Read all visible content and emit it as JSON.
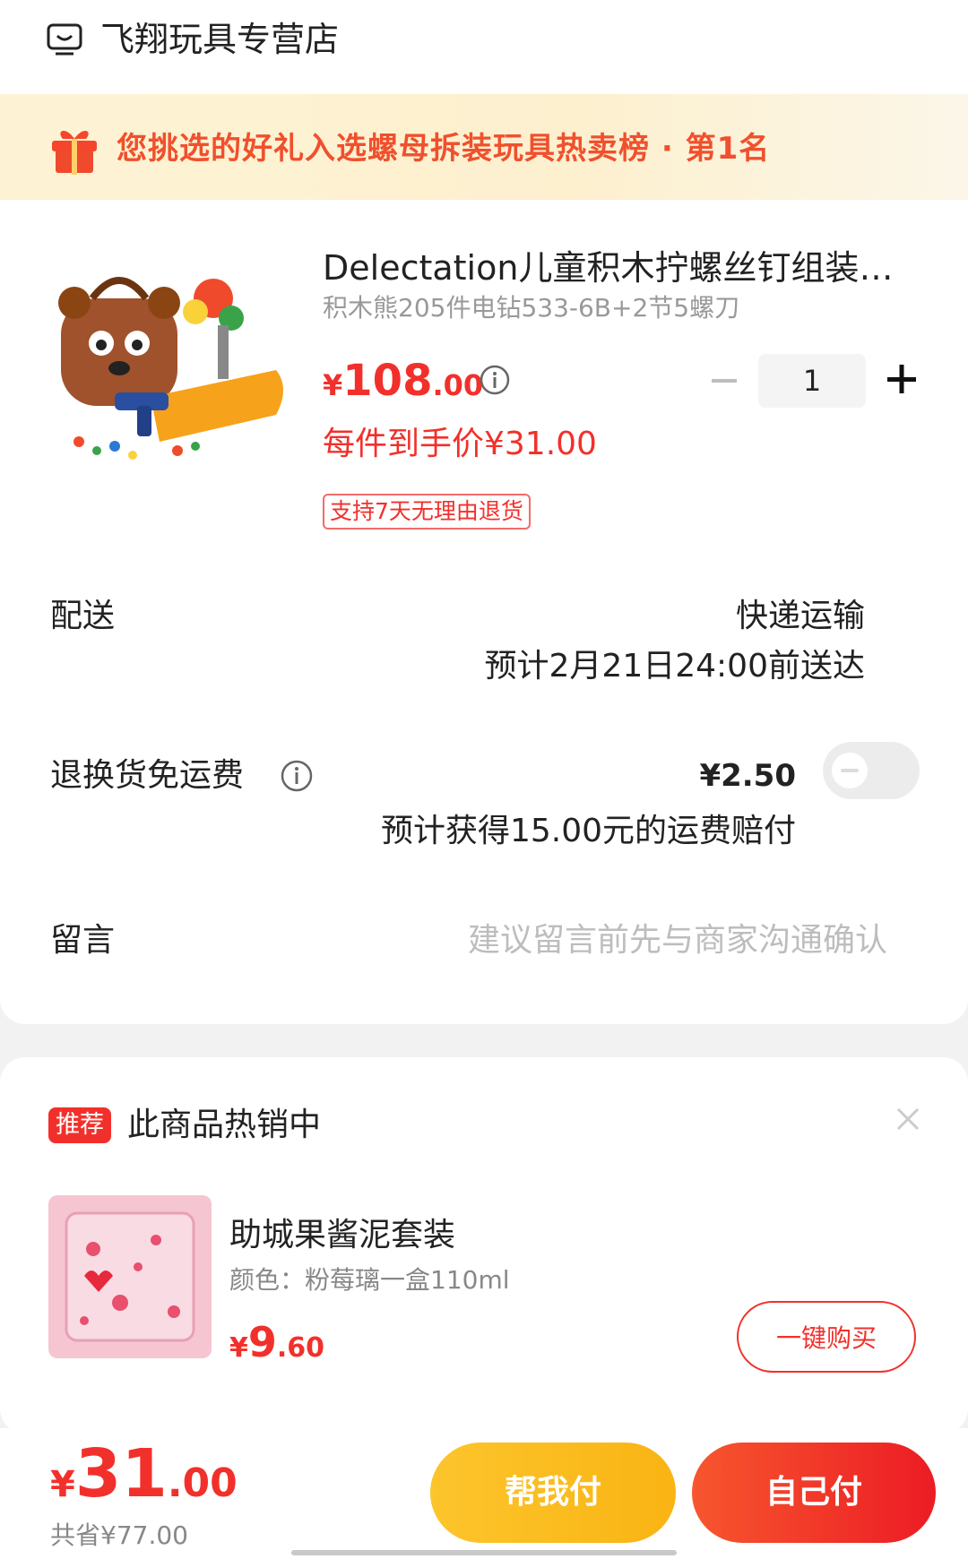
{
  "store": {
    "name": "飞翔玩具专营店",
    "icon": "store-icon"
  },
  "banner": {
    "text": "您挑选的好礼入选螺母拆装玩具热卖榜 · 第1名",
    "icon": "gift-icon"
  },
  "product": {
    "title": "Delectation儿童积木拧螺丝钉组装拆装玩具",
    "variant": "积木熊205件电钻533-6B+2节5螺刀",
    "price_symbol": "¥",
    "price_int": "108",
    "price_dec": ".00",
    "unit_price": "每件到手价¥31.00",
    "return_badge": "支持7天无理由退货",
    "quantity": "1"
  },
  "delivery": {
    "label": "配送",
    "method": "快递运输",
    "eta": "预计2月21日24:00前送达"
  },
  "refund_shipping": {
    "label": "退换货免运费",
    "price": "¥2.50",
    "note": "预计获得15.00元的运费赔付",
    "enabled": false
  },
  "message": {
    "label": "留言",
    "placeholder": "建议留言前先与商家沟通确认"
  },
  "recommend": {
    "badge": "推荐",
    "title": "此商品热销中",
    "item": {
      "name": "助城果酱泥套装",
      "variant": "颜色：粉莓璃一盒110ml",
      "price_symbol": "¥",
      "price_int": "9",
      "price_dec": ".60",
      "buy_label": "一键购买"
    }
  },
  "footer": {
    "price_symbol": "¥",
    "price_int": "31",
    "price_dec": ".00",
    "savings": "共省¥77.00",
    "help_pay": "帮我付",
    "self_pay": "自己付"
  },
  "colors": {
    "accent": "#f2302b",
    "help_pay": "#fab413",
    "banner_text": "#f0502d"
  }
}
